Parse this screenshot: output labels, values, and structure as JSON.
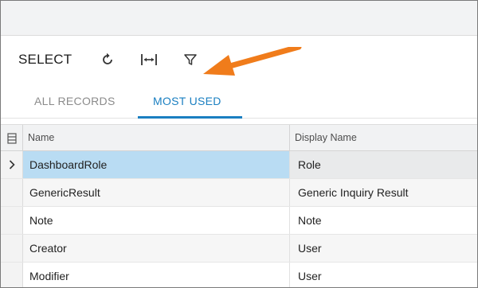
{
  "toolbar": {
    "select_label": "SELECT",
    "icons": [
      "refresh-icon",
      "fit-to-screen-icon",
      "filter-icon"
    ]
  },
  "callout": {
    "color": "#f07c1b",
    "points_to": "filter-icon"
  },
  "tabs": [
    {
      "label": "ALL RECORDS",
      "active": false
    },
    {
      "label": "MOST USED",
      "active": true
    }
  ],
  "accent_color": "#1a7fc1",
  "grid": {
    "columns": [
      "Name",
      "Display Name"
    ],
    "rows": [
      {
        "name": "DashboardRole",
        "display_name": "Role",
        "selected": true
      },
      {
        "name": "GenericResult",
        "display_name": "Generic Inquiry Result",
        "selected": false
      },
      {
        "name": "Note",
        "display_name": "Note",
        "selected": false
      },
      {
        "name": "Creator",
        "display_name": "User",
        "selected": false
      },
      {
        "name": "Modifier",
        "display_name": "User",
        "selected": false
      }
    ]
  }
}
